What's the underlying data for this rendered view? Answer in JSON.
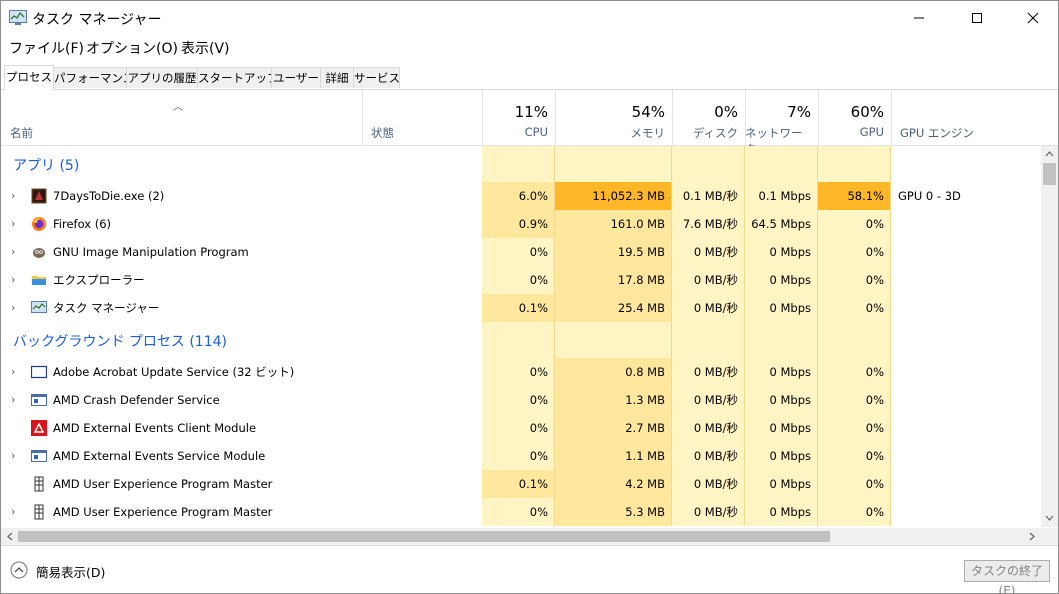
{
  "window": {
    "title": "タスク マネージャー",
    "controls": {
      "minimize": "—",
      "maximize": "☐",
      "close": "✕"
    }
  },
  "menu": [
    "ファイル(F)",
    "オプション(O)",
    "表示(V)"
  ],
  "tabs": [
    "プロセス",
    "パフォーマンス",
    "アプリの履歴",
    "スタートアップ",
    "ユーザー",
    "詳細",
    "サービス"
  ],
  "active_tab": "プロセス",
  "columns": {
    "name": "名前",
    "status": "状態",
    "cpu": {
      "pct": "11%",
      "label": "CPU"
    },
    "memory": {
      "pct": "54%",
      "label": "メモリ"
    },
    "disk": {
      "pct": "0%",
      "label": "ディスク"
    },
    "network": {
      "pct": "7%",
      "label": "ネットワーク"
    },
    "gpu": {
      "pct": "60%",
      "label": "GPU"
    },
    "gpu_engine": "GPU エンジン"
  },
  "groups": {
    "apps": "アプリ (5)",
    "background": "バックグラウンド プロセス (114)"
  },
  "apps": [
    {
      "name": "7DaysToDie.exe (2)",
      "icon": "game-icon",
      "cpu": "6.0%",
      "mem": "11,052.3 MB",
      "disk": "0.1 MB/秒",
      "net": "0.1 Mbps",
      "gpu": "58.1%",
      "gpu_engine": "GPU 0 - 3D"
    },
    {
      "name": "Firefox (6)",
      "icon": "firefox-icon",
      "cpu": "0.9%",
      "mem": "161.0 MB",
      "disk": "7.6 MB/秒",
      "net": "64.5 Mbps",
      "gpu": "0%",
      "gpu_engine": ""
    },
    {
      "name": "GNU Image Manipulation Program",
      "icon": "gimp-icon",
      "cpu": "0%",
      "mem": "19.5 MB",
      "disk": "0 MB/秒",
      "net": "0 Mbps",
      "gpu": "0%",
      "gpu_engine": ""
    },
    {
      "name": "エクスプローラー",
      "icon": "folder-icon",
      "cpu": "0%",
      "mem": "17.8 MB",
      "disk": "0 MB/秒",
      "net": "0 Mbps",
      "gpu": "0%",
      "gpu_engine": ""
    },
    {
      "name": "タスク マネージャー",
      "icon": "task-manager-icon",
      "cpu": "0.1%",
      "mem": "25.4 MB",
      "disk": "0 MB/秒",
      "net": "0 Mbps",
      "gpu": "0%",
      "gpu_engine": ""
    }
  ],
  "background": [
    {
      "name": "Adobe Acrobat Update Service (32 ビット)",
      "icon": "window-icon",
      "cpu": "0%",
      "mem": "0.8 MB",
      "disk": "0 MB/秒",
      "net": "0 Mbps",
      "gpu": "0%"
    },
    {
      "name": "AMD Crash Defender Service",
      "icon": "service-icon",
      "cpu": "0%",
      "mem": "1.3 MB",
      "disk": "0 MB/秒",
      "net": "0 Mbps",
      "gpu": "0%"
    },
    {
      "name": "AMD External Events Client Module",
      "icon": "amd-icon",
      "cpu": "0%",
      "mem": "2.7 MB",
      "disk": "0 MB/秒",
      "net": "0 Mbps",
      "gpu": "0%"
    },
    {
      "name": "AMD External Events Service Module",
      "icon": "service-icon",
      "cpu": "0%",
      "mem": "1.1 MB",
      "disk": "0 MB/秒",
      "net": "0 Mbps",
      "gpu": "0%"
    },
    {
      "name": "AMD User Experience Program Master",
      "icon": "program-icon",
      "cpu": "0.1%",
      "mem": "4.2 MB",
      "disk": "0 MB/秒",
      "net": "0 Mbps",
      "gpu": "0%"
    },
    {
      "name": "AMD User Experience Program Master",
      "icon": "program-icon",
      "cpu": "0%",
      "mem": "5.3 MB",
      "disk": "0 MB/秒",
      "net": "0 Mbps",
      "gpu": "0%"
    }
  ],
  "footer": {
    "fewer_details": "簡易表示(D)",
    "end_task": "タスクの終了(E)"
  },
  "colors": {
    "heat_light": "#fff4c4",
    "heat_mid": "#ffe89e",
    "heat_strong": "#ffc43c",
    "heat_hot": "#ffb627",
    "group_text": "#1c5fd0"
  }
}
